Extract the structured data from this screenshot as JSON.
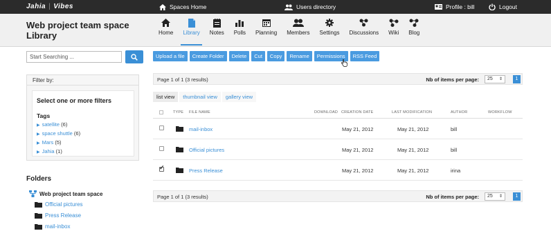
{
  "topbar": {
    "logo_left": "Jahia",
    "logo_right": "Vibes",
    "spaces_home": "Spaces Home",
    "users_directory": "Users directory",
    "profile": "Profile : bill",
    "logout": "Logout"
  },
  "site_title": "Web project team space Library",
  "nav": [
    {
      "label": "Home",
      "icon": "home-icon"
    },
    {
      "label": "Library",
      "icon": "document-icon",
      "active": true
    },
    {
      "label": "Notes",
      "icon": "notes-icon"
    },
    {
      "label": "Polls",
      "icon": "polls-icon"
    },
    {
      "label": "Planning",
      "icon": "calendar-icon"
    },
    {
      "label": "Members",
      "icon": "members-icon"
    },
    {
      "label": "Settings",
      "icon": "gear-icon"
    },
    {
      "label": "Discussions",
      "icon": "discussions-icon"
    },
    {
      "label": "Wiki",
      "icon": "wiki-icon"
    },
    {
      "label": "Blog",
      "icon": "blog-icon"
    }
  ],
  "search": {
    "placeholder": "Start Searching ..."
  },
  "toolbar": [
    "Upload a file",
    "Create Folder",
    "Delete",
    "Cut",
    "Copy",
    "Rename",
    "Permissions",
    "RSS Feed"
  ],
  "filter": {
    "title": "Filter by:",
    "heading": "Select one or more filters",
    "tags_heading": "Tags",
    "tags": [
      {
        "name": "satellite",
        "count": "(6)"
      },
      {
        "name": "space shuttle",
        "count": "(6)"
      },
      {
        "name": "Mars",
        "count": "(5)"
      },
      {
        "name": "Jahia",
        "count": "(1)"
      }
    ]
  },
  "folders": {
    "heading": "Folders",
    "root": "Web project team space",
    "items": [
      "Official pictures",
      "Press Release",
      "mail-inbox"
    ]
  },
  "pager": {
    "summary": "Page 1 of 1 (3 results)",
    "items_label": "Nb of items per page:",
    "items_value": "25",
    "page": "1"
  },
  "views": [
    "list view",
    "thumbnail view",
    "gallery view"
  ],
  "columns": {
    "type": "TYPE",
    "file_name": "FILE NAME",
    "download": "DOWNLOAD",
    "creation_date": "CREATION DATE",
    "last_modification": "LAST MODIFICATION",
    "author": "AUTHOR",
    "workflow": "WORKFLOW"
  },
  "rows": [
    {
      "name": "mail-inbox",
      "created": "May 21, 2012",
      "modified": "May 21, 2012",
      "author": "bill",
      "checked": false
    },
    {
      "name": "Official pictures",
      "created": "May 21, 2012",
      "modified": "May 21, 2012",
      "author": "bill",
      "checked": false
    },
    {
      "name": "Press Release",
      "created": "May 21, 2012",
      "modified": "May 21, 2012",
      "author": "irina",
      "checked": true
    }
  ]
}
